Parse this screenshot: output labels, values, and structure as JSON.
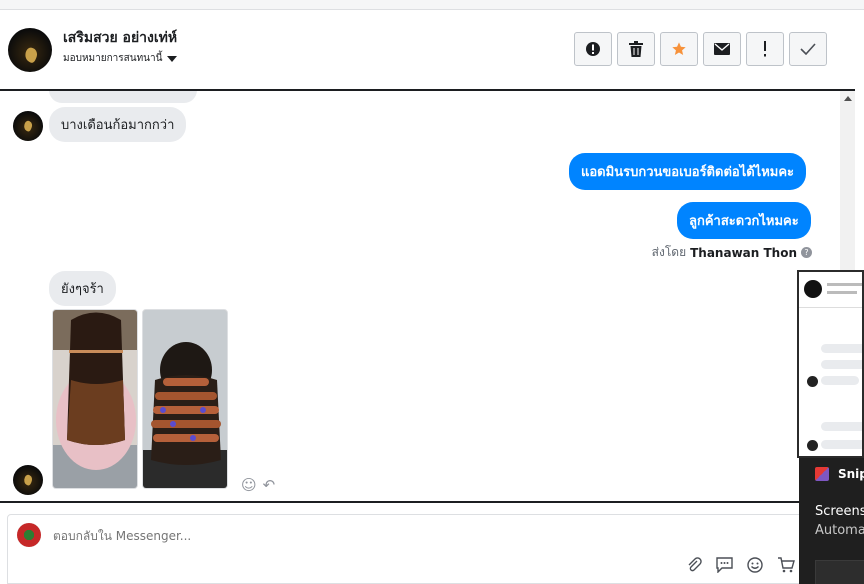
{
  "header": {
    "page_name": "เสริมสวย อย่างเท่ห์",
    "assign_label": "มอบหมายการสนทนานี้",
    "actions": [
      {
        "name": "spam-button",
        "icon": "alert-circle-icon"
      },
      {
        "name": "delete-button",
        "icon": "trash-icon"
      },
      {
        "name": "star-button",
        "icon": "star-icon"
      },
      {
        "name": "unread-button",
        "icon": "envelope-icon"
      },
      {
        "name": "follow-up-button",
        "icon": "exclamation-icon"
      },
      {
        "name": "done-button",
        "icon": "check-icon"
      }
    ],
    "star_color": "#f7923b"
  },
  "messages": {
    "incoming_1": "บางเดือนก้อมากกว่า",
    "outgoing_1": "แอดมินรบกวนขอเบอร์ติดต่อได้ไหมคะ",
    "outgoing_2": "ลูกค้าสะดวกไหมคะ",
    "sent_by_prefix": "ส่งโดย",
    "sent_by_name": "Thanawan Thon",
    "incoming_2": "ยังๆจร้า"
  },
  "composer": {
    "placeholder": "ตอบกลับใน Messenger..."
  },
  "snip": {
    "title": "Snip",
    "line1": "Screensh",
    "line2": "Automa"
  },
  "colors": {
    "outgoing_bubble": "#0084ff",
    "incoming_bubble": "#e9ebee"
  }
}
